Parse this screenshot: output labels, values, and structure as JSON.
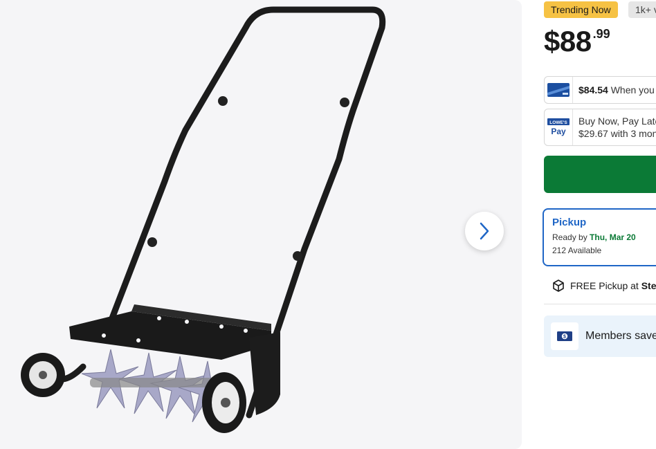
{
  "badges": {
    "trending": "Trending Now",
    "views": "1k+ v"
  },
  "price": {
    "dollars": "$88",
    "cents": ".99"
  },
  "credit_offer": {
    "amount": "$84.54",
    "text": "When you"
  },
  "pay_offer": {
    "logo_top": "LOWE'S",
    "logo_bottom": "Pay",
    "line1": "Buy Now, Pay Late",
    "line2": "$29.67 with 3 mont"
  },
  "pickup": {
    "title": "Pickup",
    "ready_prefix": "Ready by",
    "ready_date": "Thu, Mar 20",
    "available": "212 Available"
  },
  "free_pickup": {
    "prefix": "FREE Pickup at",
    "store": "Ster"
  },
  "members": {
    "text": "Members save"
  },
  "icons": {
    "next": "chevron-right-icon",
    "box": "package-icon",
    "members": "dollar-bill-icon"
  },
  "colors": {
    "accent_blue": "#1f66c6",
    "cta_green": "#0b7a36",
    "badge_yellow": "#f6c244"
  }
}
